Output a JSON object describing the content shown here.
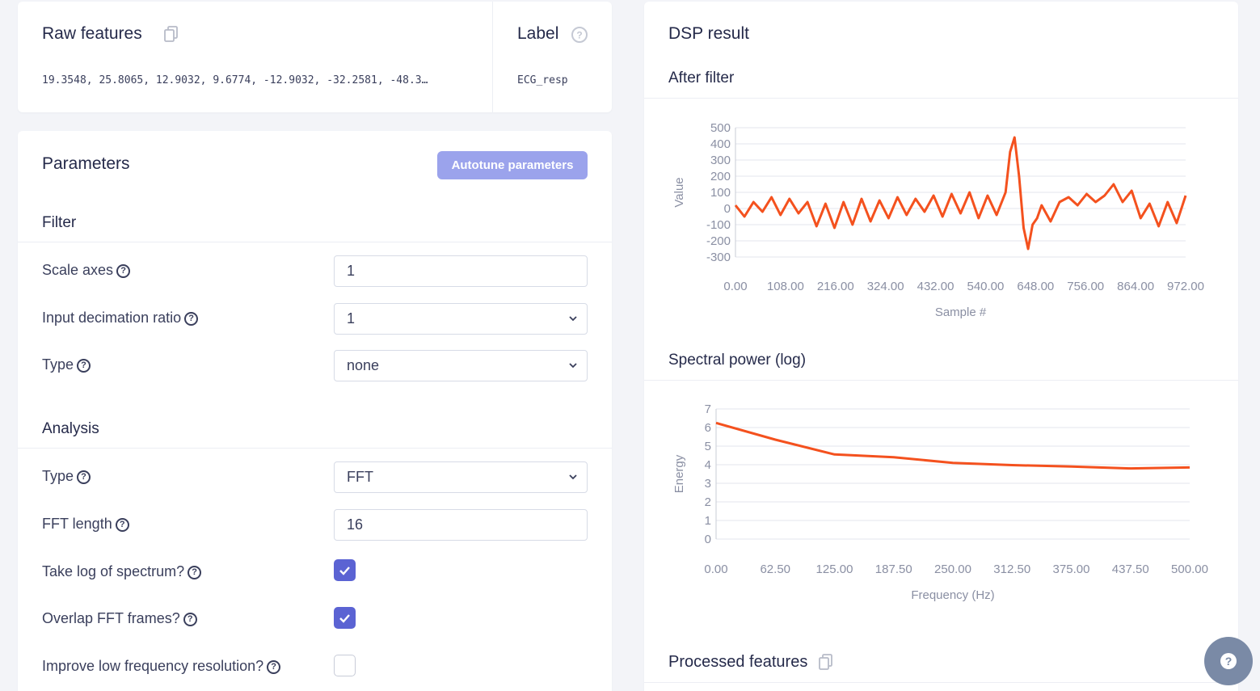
{
  "raw_features": {
    "title": "Raw features",
    "values": "19.3548, 25.8065, 12.9032, 9.6774, -12.9032, -32.2581, -48.3…"
  },
  "label": {
    "title": "Label",
    "value": "ECG_resp"
  },
  "parameters": {
    "title": "Parameters",
    "autotune_label": "Autotune parameters",
    "filter": {
      "title": "Filter",
      "scale_axes_label": "Scale axes",
      "scale_axes_value": "1",
      "decimation_label": "Input decimation ratio",
      "decimation_value": "1",
      "type_label": "Type",
      "type_value": "none"
    },
    "analysis": {
      "title": "Analysis",
      "type_label": "Type",
      "type_value": "FFT",
      "fft_length_label": "FFT length",
      "fft_length_value": "16",
      "log_spectrum_label": "Take log of spectrum?",
      "log_spectrum_checked": true,
      "overlap_label": "Overlap FFT frames?",
      "overlap_checked": true,
      "low_freq_label": "Improve low frequency resolution?",
      "low_freq_checked": false
    }
  },
  "dsp": {
    "title": "DSP result",
    "after_filter_title": "After filter",
    "spectral_title": "Spectral power (log)",
    "processed_title": "Processed features"
  },
  "colors": {
    "accent": "#5b63d3",
    "autotune": "#9ba3ec",
    "series": "#f4511e"
  },
  "chart_data": [
    {
      "type": "line",
      "ylabel": "Value",
      "xlabel": "Sample #",
      "ylim": [
        -300,
        500
      ],
      "xlim": [
        0,
        1000
      ],
      "yticks": [
        "500",
        "400",
        "300",
        "200",
        "100",
        "0",
        "-100",
        "-200",
        "-300"
      ],
      "xticks": [
        "0.00",
        "108.00",
        "216.00",
        "324.00",
        "432.00",
        "540.00",
        "648.00",
        "756.00",
        "864.00",
        "972.00"
      ],
      "series": [
        {
          "x": [
            0,
            20,
            40,
            60,
            80,
            100,
            120,
            140,
            160,
            180,
            200,
            220,
            240,
            260,
            280,
            300,
            320,
            340,
            360,
            380,
            400,
            420,
            440,
            460,
            480,
            500,
            520,
            540,
            560,
            580,
            600,
            610,
            620,
            630,
            640,
            650,
            660,
            670,
            680,
            700,
            720,
            740,
            760,
            780,
            800,
            820,
            840,
            860,
            880,
            900,
            920,
            940,
            960,
            980,
            1000
          ],
          "values": [
            20,
            -50,
            40,
            -20,
            70,
            -40,
            60,
            -30,
            40,
            -110,
            30,
            -120,
            40,
            -100,
            60,
            -80,
            50,
            -60,
            70,
            -40,
            60,
            -20,
            80,
            -50,
            90,
            -30,
            100,
            -60,
            80,
            -40,
            100,
            350,
            440,
            200,
            -120,
            -250,
            -100,
            -60,
            20,
            -80,
            40,
            70,
            20,
            90,
            40,
            80,
            150,
            40,
            110,
            -60,
            30,
            -110,
            40,
            -90,
            80
          ]
        }
      ]
    },
    {
      "type": "line",
      "ylabel": "Energy",
      "xlabel": "Frequency (Hz)",
      "ylim": [
        0,
        7
      ],
      "xlim": [
        0,
        500
      ],
      "yticks": [
        "7",
        "6",
        "5",
        "4",
        "3",
        "2",
        "1",
        "0"
      ],
      "xticks": [
        "0.00",
        "62.50",
        "125.00",
        "187.50",
        "250.00",
        "312.50",
        "375.00",
        "437.50",
        "500.00"
      ],
      "series": [
        {
          "x": [
            0,
            62.5,
            125,
            187.5,
            250,
            312.5,
            375,
            437.5,
            500
          ],
          "values": [
            6.25,
            5.35,
            4.55,
            4.4,
            4.1,
            3.98,
            3.9,
            3.8,
            3.85
          ]
        }
      ]
    }
  ]
}
